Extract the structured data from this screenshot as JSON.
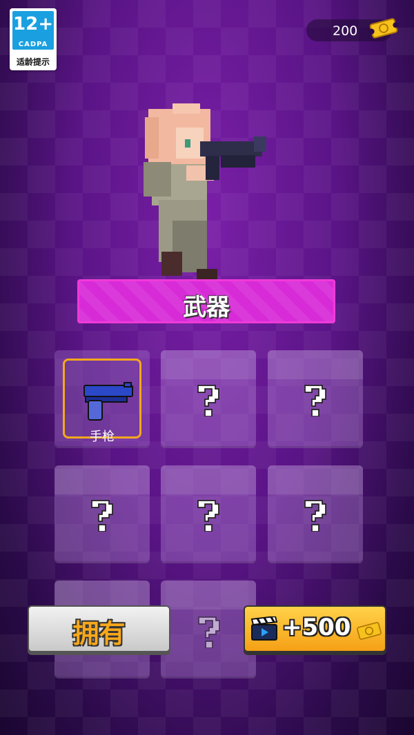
{
  "age_badge": {
    "rating": "12+",
    "org": "CADPA",
    "tip": "适龄提示"
  },
  "currency": {
    "amount": "200",
    "icon": "ticket-coin-icon"
  },
  "category": {
    "title": "武器"
  },
  "grid": {
    "items": [
      {
        "label": "手枪",
        "state": "owned-selected",
        "icon": "pistol-icon"
      },
      {
        "label": "",
        "state": "locked",
        "icon": "question-mark-icon"
      },
      {
        "label": "",
        "state": "locked",
        "icon": "question-mark-icon"
      },
      {
        "label": "",
        "state": "locked",
        "icon": "question-mark-icon"
      },
      {
        "label": "",
        "state": "locked",
        "icon": "question-mark-icon"
      },
      {
        "label": "",
        "state": "locked",
        "icon": "question-mark-icon"
      },
      {
        "label": "",
        "state": "locked",
        "icon": "question-mark-icon"
      },
      {
        "label": "",
        "state": "locked",
        "icon": "question-mark-icon"
      }
    ]
  },
  "buttons": {
    "own_label": "拥有",
    "reward_label": "+500",
    "reward_icon": "video-clapper-icon"
  },
  "colors": {
    "banner": "#d82bd8",
    "selected_border": "#f7a81c",
    "reward_button": "#f5b021",
    "own_text": "#f7a81c"
  }
}
